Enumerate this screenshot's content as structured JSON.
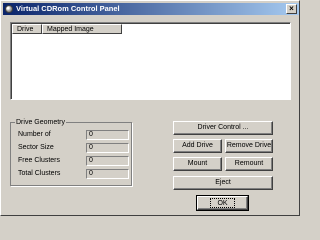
{
  "window": {
    "title": "Virtual CDRom Control Panel",
    "close_glyph": "×"
  },
  "drive_list": {
    "columns": [
      "Drive",
      "Mapped Image"
    ],
    "rows": []
  },
  "drive_geometry": {
    "title": "Drive Geometry",
    "fields": [
      {
        "label": "Number of",
        "value": "0"
      },
      {
        "label": "Sector Size",
        "value": "0"
      },
      {
        "label": "Free Clusters",
        "value": "0"
      },
      {
        "label": "Total Clusters",
        "value": "0"
      }
    ]
  },
  "buttons": {
    "driver_control": "Driver Control ...",
    "add_drive": "Add Drive",
    "remove_drive": "Remove Drive",
    "mount": "Mount",
    "remount": "Remount",
    "eject": "Eject",
    "ok": "OK"
  },
  "icons": {
    "app_icon": "cdrom-icon",
    "close_icon": "close-icon"
  }
}
